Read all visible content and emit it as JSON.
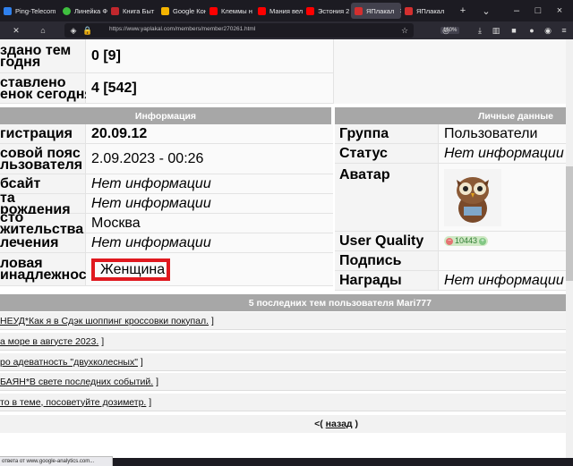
{
  "browser": {
    "tabs": [
      {
        "label": "Ping-Telecom",
        "color": "#2f80ed"
      },
      {
        "label": "Линейка Ф",
        "color": "#3fbf3f"
      },
      {
        "label": "Книга Быт",
        "color": "#c1272d"
      },
      {
        "label": "Google Кон",
        "color": "#f4b400"
      },
      {
        "label": "Клеммы н",
        "color": "#ff0000"
      },
      {
        "label": "Мания вел",
        "color": "#ff0000"
      },
      {
        "label": "Эстония 2",
        "color": "#ff0000"
      },
      {
        "label": "ЯПлакал",
        "color": "#d32f2f"
      },
      {
        "label": "ЯПлакал",
        "color": "#d32f2f"
      }
    ],
    "new_tab": "+",
    "url": "https://www.yaplakal.com/members/member270261.html",
    "zoom": "160%",
    "status": "ответа от www.google-analytics.com..."
  },
  "stats": [
    {
      "label": "здано тем\nгодня",
      "value": "0 [9]"
    },
    {
      "label": "ставлено\nенок сегодня",
      "value": "4 [542]"
    }
  ],
  "info": {
    "header": "Информация",
    "rows": [
      {
        "label": "гистрация",
        "value": "20.09.12",
        "bold": true
      },
      {
        "label": "совой пояс\nльзователя",
        "value": "2.09.2023 - 00:26"
      },
      {
        "label": "бсайт",
        "value": "Нет информации",
        "italic": true
      },
      {
        "label": "та рождения",
        "value": "Нет информации",
        "italic": true
      },
      {
        "label": "сто жительства",
        "value": "Москва"
      },
      {
        "label": "лечения",
        "value": "Нет информации",
        "italic": true
      },
      {
        "label": "ловая\nинадлежность",
        "value": "Женщина",
        "highlight": true
      }
    ]
  },
  "personal": {
    "header": "Личные данные",
    "rows": [
      {
        "label": "Группа",
        "value": "Пользователи"
      },
      {
        "label": "Статус",
        "value": "Нет информации",
        "italic": true
      },
      {
        "label": "Аватар",
        "value": ""
      },
      {
        "label": "User Quality",
        "value": "10443"
      },
      {
        "label": "Подпись",
        "value": ""
      },
      {
        "label": "Награды",
        "value": "Нет информации",
        "italic": true
      }
    ]
  },
  "topics": {
    "header": "5 последних тем пользователя Mari777",
    "items": [
      {
        "text": "НЕУД*Как я в Сдэк шоппинг кроссовки покупал.",
        "tail": "]"
      },
      {
        "text": "а море в августе 2023.",
        "tail": "]"
      },
      {
        "text": "ро адеватность \"двухколесных\"",
        "tail": "]"
      },
      {
        "text": "БАЯН*В свете последних событий.",
        "tail": "]"
      },
      {
        "text": "то в теме, посоветуйте дозиметр.",
        "tail": "]"
      }
    ]
  },
  "back": {
    "prefix": "<(",
    "link": "назад",
    "suffix": ")"
  }
}
